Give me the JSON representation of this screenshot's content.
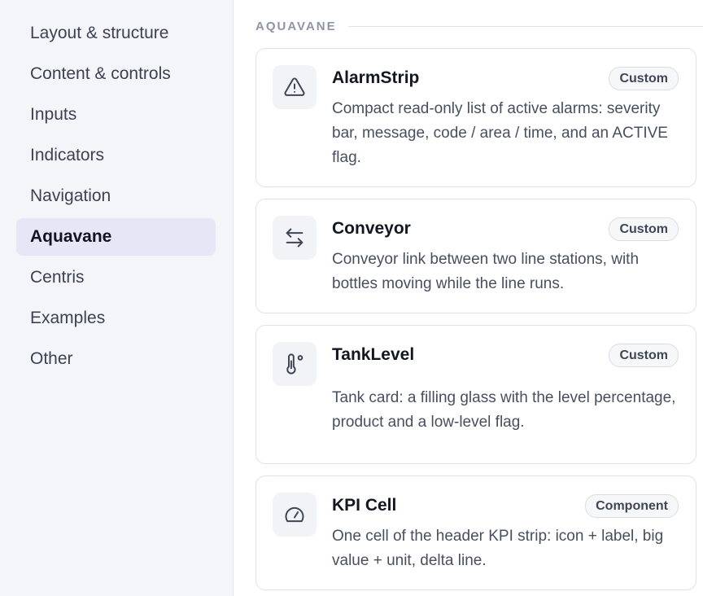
{
  "sidebar": {
    "items": [
      {
        "label": "Layout & structure",
        "active": false
      },
      {
        "label": "Content & controls",
        "active": false
      },
      {
        "label": "Inputs",
        "active": false
      },
      {
        "label": "Indicators",
        "active": false
      },
      {
        "label": "Navigation",
        "active": false
      },
      {
        "label": "Aquavane",
        "active": true
      },
      {
        "label": "Centris",
        "active": false
      },
      {
        "label": "Examples",
        "active": false
      },
      {
        "label": "Other",
        "active": false
      }
    ]
  },
  "main": {
    "section_title": "AQUAVANE",
    "cards": [
      {
        "title": "AlarmStrip",
        "badge": "Custom",
        "icon": "alert-triangle-icon",
        "description": "Compact read-only list of active alarms: severity bar, message, code / area / time, and an ACTIVE flag."
      },
      {
        "title": "Conveyor",
        "badge": "Custom",
        "icon": "arrows-left-right-icon",
        "description": "Conveyor link between two line stations, with bottles moving while the line runs."
      },
      {
        "title": "TankLevel",
        "badge": "Custom",
        "icon": "thermometer-icon",
        "description": "Tank card: a filling glass with the level percentage, product and a low-level flag."
      },
      {
        "title": "KPI Cell",
        "badge": "Component",
        "icon": "gauge-icon",
        "description": "One cell of the header KPI strip: icon + label, big value + unit, delta line."
      }
    ]
  }
}
